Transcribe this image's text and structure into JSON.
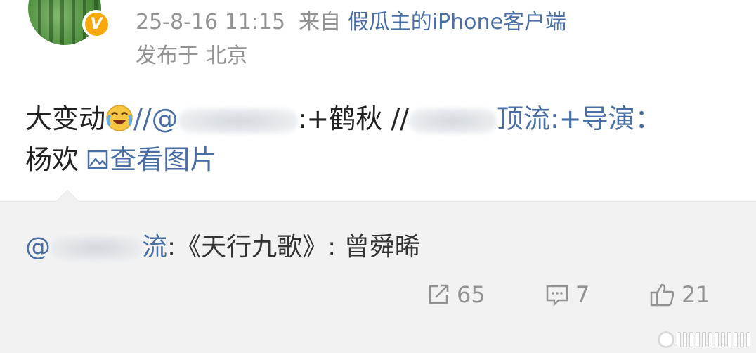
{
  "post": {
    "timestamp": "25-8-16 11:15",
    "source_prefix": "来自",
    "source_device": "假瓜主的iPhone客户端",
    "location": "发布于 北京",
    "verified_badge": "V",
    "content": {
      "part1": "大变动",
      "emoji": "laughing-crying-emoji",
      "part2": "//@",
      "part3": ":+鹤秋 //",
      "part4": "顶流:+导演：",
      "line2": "杨欢",
      "view_image": "查看图片"
    }
  },
  "repost": {
    "at": "@",
    "name_tail": "流",
    "text": ":《天行九歌》: 曾舜晞"
  },
  "actions": {
    "share_count": "65",
    "comment_count": "7",
    "like_count": "21"
  },
  "colors": {
    "link": "#4a6fa5",
    "meta": "#939393",
    "text": "#222222",
    "repost_bg": "#f2f2f2",
    "badge": "#f7a90a"
  }
}
